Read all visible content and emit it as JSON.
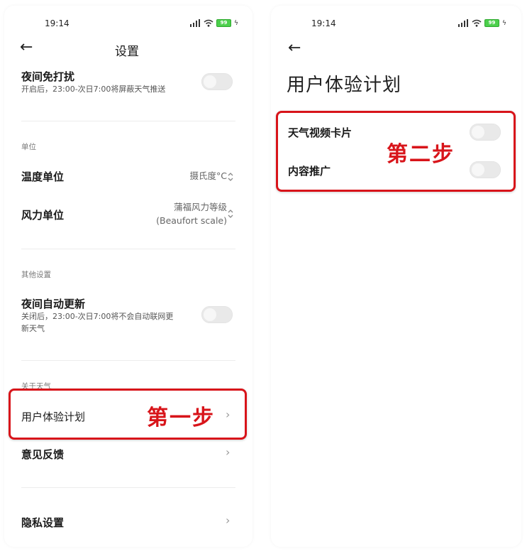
{
  "left": {
    "status": {
      "time": "19:14",
      "battery": "99"
    },
    "header": {
      "title": "设置"
    },
    "night_dnd": {
      "title": "夜间免打扰",
      "desc": "开启后，23:00-次日7:00将屏蔽天气推送",
      "on": false
    },
    "units_section": "单位",
    "temp_unit": {
      "title": "温度单位",
      "value": "摄氏度°C"
    },
    "wind_unit": {
      "title": "风力单位",
      "value_line1": "蒲福风力等级",
      "value_line2": "(Beaufort scale)"
    },
    "other_section": "其他设置",
    "night_update": {
      "title": "夜间自动更新",
      "desc_line1": "关闭后，23:00-次日7:00将不会自动联网更",
      "desc_line2": "新天气",
      "on": false
    },
    "about_section": "关于天气",
    "ux_plan": {
      "title": "用户体验计划"
    },
    "step1": "第一步",
    "feedback": {
      "title": "意见反馈"
    },
    "privacy": {
      "title": "隐私设置"
    }
  },
  "right": {
    "status": {
      "time": "19:14",
      "battery": "99"
    },
    "title": "用户体验计划",
    "weather_video": {
      "title": "天气视频卡片",
      "on": false
    },
    "content_promo": {
      "title": "内容推广",
      "on": false
    },
    "step2": "第二步"
  },
  "colors": {
    "highlight": "#d8141a",
    "battery": "#4ccf4c"
  },
  "icons": [
    "back-arrow-icon",
    "signal-icon",
    "wifi-icon",
    "battery-icon",
    "charging-icon",
    "chevron-right-icon",
    "updown-icon"
  ]
}
